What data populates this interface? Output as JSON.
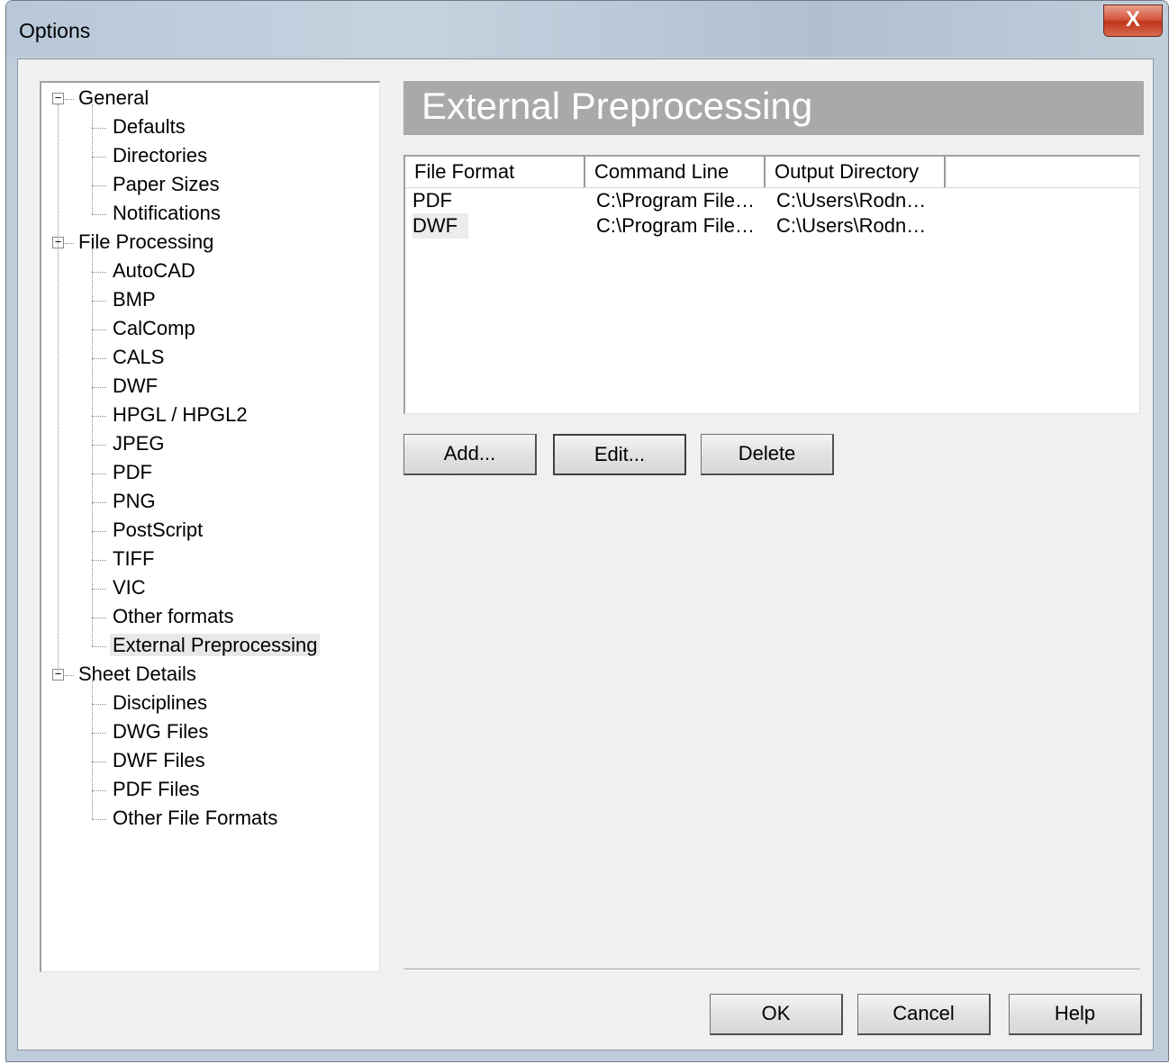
{
  "window": {
    "title": "Options",
    "close_label": "X"
  },
  "tree": {
    "groups": [
      {
        "label": "General",
        "toggle": "−",
        "children": [
          "Defaults",
          "Directories",
          "Paper Sizes",
          "Notifications"
        ]
      },
      {
        "label": "File Processing",
        "toggle": "−",
        "children": [
          "AutoCAD",
          "BMP",
          "CalComp",
          "CALS",
          "DWF",
          "HPGL / HPGL2",
          "JPEG",
          "PDF",
          "PNG",
          "PostScript",
          "TIFF",
          "VIC",
          "Other formats",
          "External Preprocessing"
        ]
      },
      {
        "label": "Sheet Details",
        "toggle": "−",
        "children": [
          "Disciplines",
          "DWG Files",
          "DWF Files",
          "PDF Files",
          "Other File Formats"
        ]
      }
    ],
    "selected": "External Preprocessing"
  },
  "panel": {
    "title": "External Preprocessing"
  },
  "list": {
    "columns": [
      "File Format",
      "Command Line",
      "Output Directory"
    ],
    "rows": [
      [
        "PDF",
        "C:\\Program File…",
        "C:\\Users\\Rodn…"
      ],
      [
        "DWF",
        "C:\\Program File…",
        "C:\\Users\\Rodn…"
      ]
    ]
  },
  "actions": {
    "add": "Add...",
    "edit": "Edit...",
    "delete": "Delete"
  },
  "footer": {
    "ok": "OK",
    "cancel": "Cancel",
    "help": "Help"
  }
}
